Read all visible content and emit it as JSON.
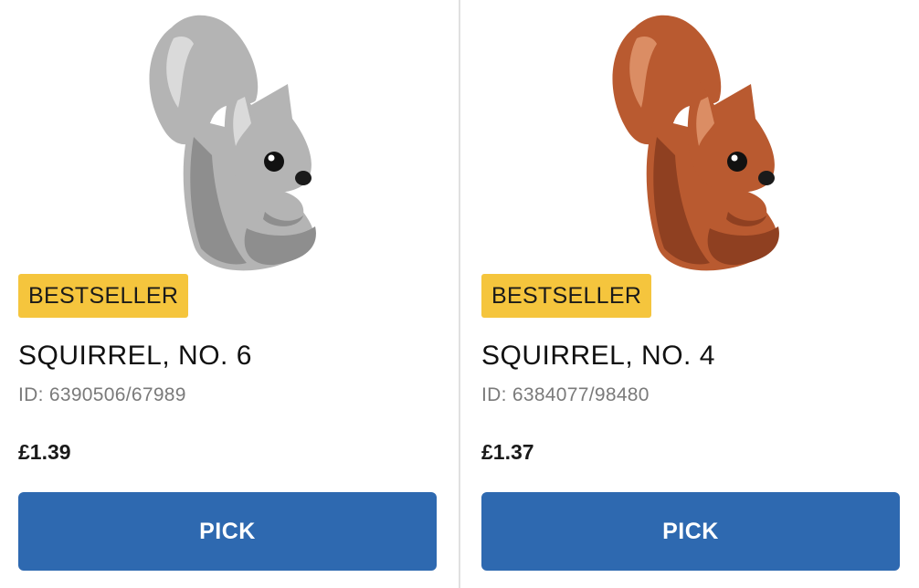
{
  "products": [
    {
      "badge": "BESTSELLER",
      "name": "SQUIRREL, NO. 6",
      "id_text": "ID: 6390506/67989",
      "price": "£1.39",
      "button_label": "PICK",
      "image_icon": "grey-squirrel-figure",
      "colors": {
        "body": "#b4b4b4",
        "shade": "#8e8e8e",
        "highlight": "#e4e4e4"
      }
    },
    {
      "badge": "BESTSELLER",
      "name": "SQUIRREL, NO. 4",
      "id_text": "ID: 6384077/98480",
      "price": "£1.37",
      "button_label": "PICK",
      "image_icon": "brown-squirrel-figure",
      "colors": {
        "body": "#b95a30",
        "shade": "#8f4021",
        "highlight": "#e39a72"
      }
    }
  ],
  "theme": {
    "badge_color": "#f5c53d",
    "button_color": "#2e69b0",
    "divider_color": "#e0e0e0"
  }
}
